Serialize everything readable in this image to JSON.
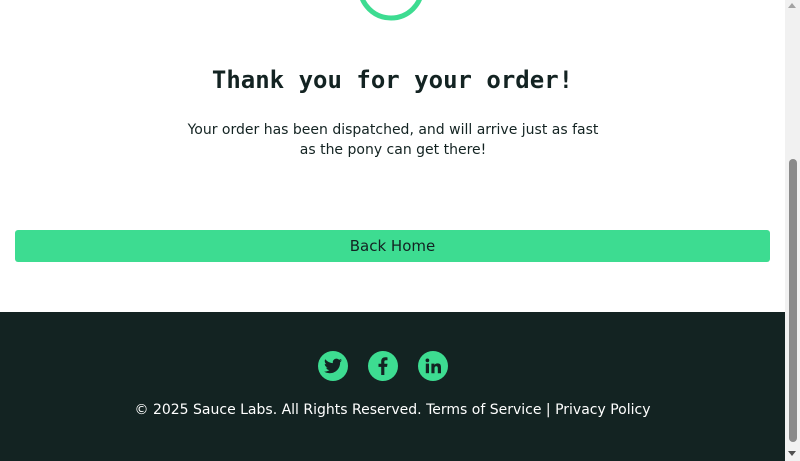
{
  "checkout_complete": {
    "header": "Thank you for your order!",
    "text": "Your order has been dispatched, and will arrive just as fast as the pony can get there!",
    "back_home_label": "Back Home",
    "accent_color": "#3ddc91"
  },
  "footer": {
    "background_color": "#132322",
    "social": [
      {
        "name": "twitter",
        "icon": "twitter-icon"
      },
      {
        "name": "facebook",
        "icon": "facebook-icon"
      },
      {
        "name": "linkedin",
        "icon": "linkedin-icon"
      }
    ],
    "copy_prefix": "© 2025 Sauce Labs. All Rights Reserved. ",
    "terms_label": "Terms of Service",
    "separator": " | ",
    "privacy_label": "Privacy Policy"
  }
}
